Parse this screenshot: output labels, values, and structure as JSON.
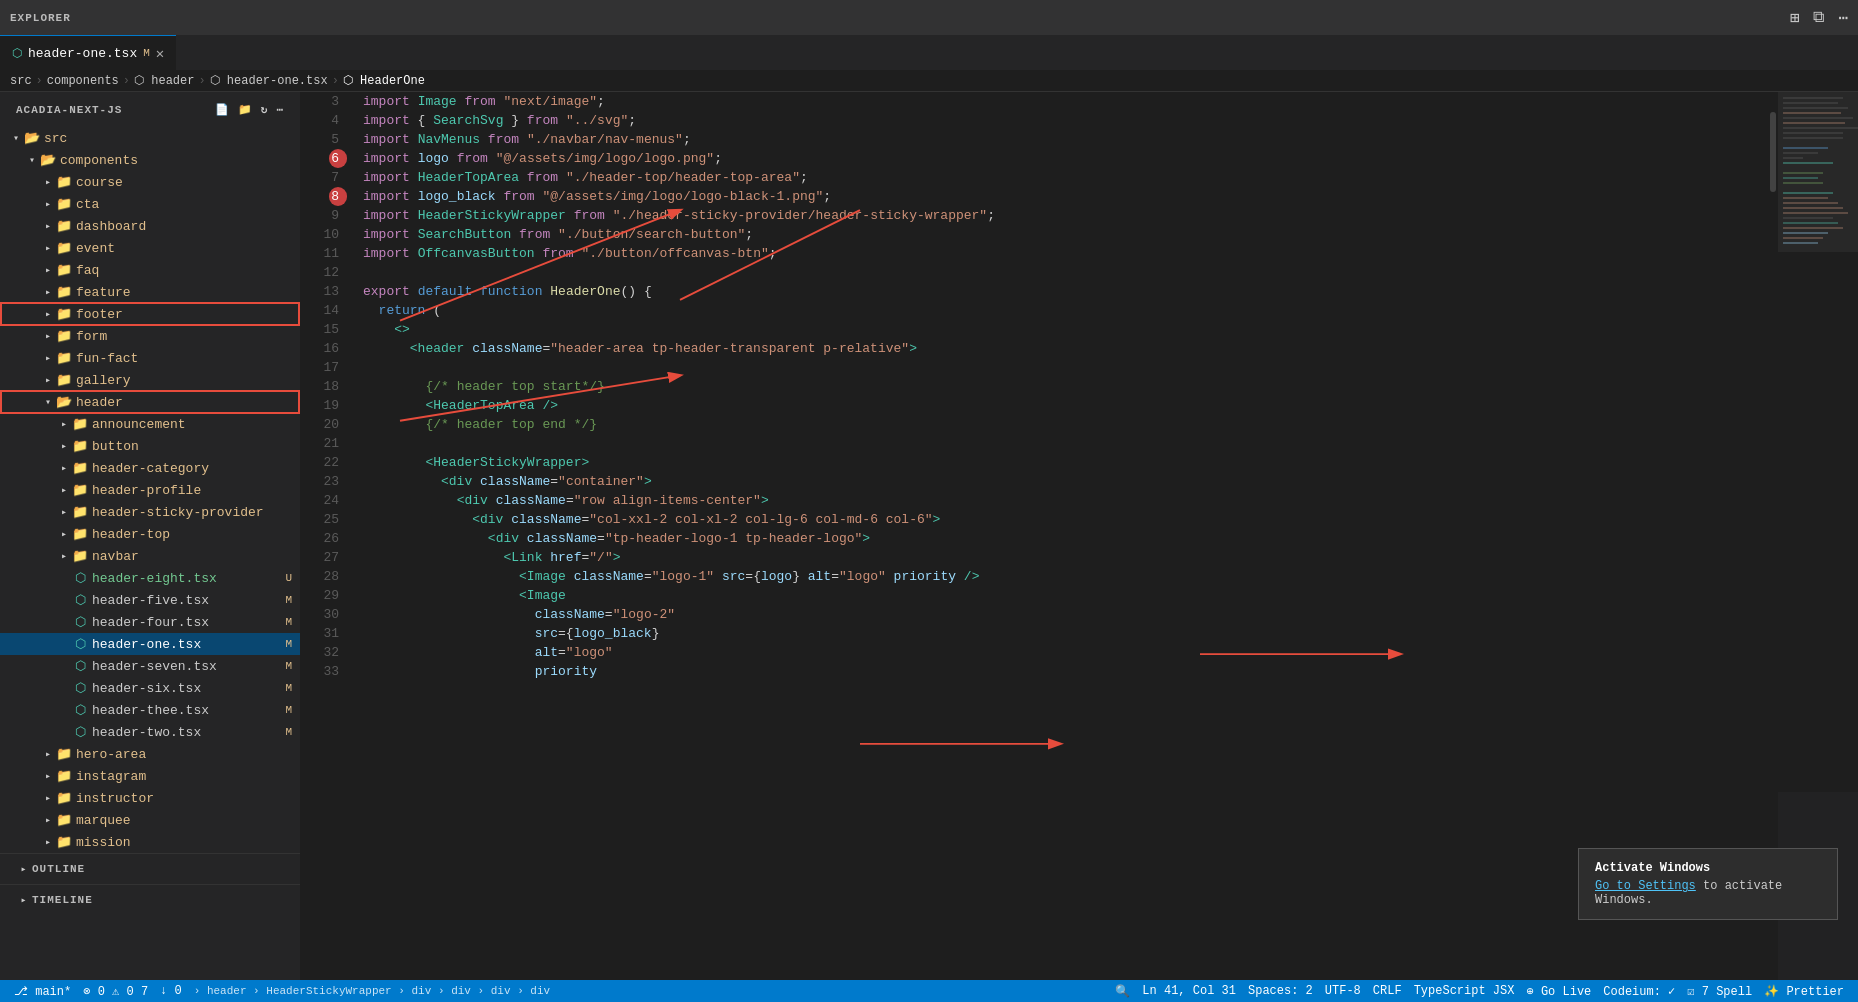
{
  "titlebar": {
    "explorer_label": "EXPLORER",
    "icons": [
      "⋯"
    ]
  },
  "tabs": [
    {
      "id": "header-one",
      "label": "header-one.tsx",
      "badge": "M",
      "active": true,
      "closable": true
    }
  ],
  "breadcrumb": [
    "src",
    "components",
    "header",
    "header-one.tsx",
    "HeaderOne"
  ],
  "project": {
    "name": "ACADIA-NEXT-JS",
    "root": "src",
    "tree": [
      {
        "type": "folder",
        "label": "src",
        "indent": 0,
        "expanded": true
      },
      {
        "type": "folder",
        "label": "components",
        "indent": 1,
        "expanded": true
      },
      {
        "type": "folder",
        "label": "course",
        "indent": 2,
        "expanded": false
      },
      {
        "type": "folder",
        "label": "cta",
        "indent": 2,
        "expanded": false
      },
      {
        "type": "folder",
        "label": "dashboard",
        "indent": 2,
        "expanded": false
      },
      {
        "type": "folder",
        "label": "event",
        "indent": 2,
        "expanded": false
      },
      {
        "type": "folder",
        "label": "faq",
        "indent": 2,
        "expanded": false
      },
      {
        "type": "folder",
        "label": "feature",
        "indent": 2,
        "expanded": false
      },
      {
        "type": "folder",
        "label": "footer",
        "indent": 2,
        "expanded": false
      },
      {
        "type": "folder",
        "label": "form",
        "indent": 2,
        "expanded": false
      },
      {
        "type": "folder",
        "label": "fun-fact",
        "indent": 2,
        "expanded": false
      },
      {
        "type": "folder",
        "label": "gallery",
        "indent": 2,
        "expanded": false
      },
      {
        "type": "folder",
        "label": "header",
        "indent": 2,
        "expanded": true,
        "selected": true
      },
      {
        "type": "folder",
        "label": "announcement",
        "indent": 3,
        "expanded": false
      },
      {
        "type": "folder",
        "label": "button",
        "indent": 3,
        "expanded": false
      },
      {
        "type": "folder",
        "label": "header-category",
        "indent": 3,
        "expanded": false
      },
      {
        "type": "folder",
        "label": "header-profile",
        "indent": 3,
        "expanded": false
      },
      {
        "type": "folder",
        "label": "header-sticky-provider",
        "indent": 3,
        "expanded": false
      },
      {
        "type": "folder",
        "label": "header-top",
        "indent": 3,
        "expanded": false
      },
      {
        "type": "folder",
        "label": "navbar",
        "indent": 3,
        "expanded": false
      },
      {
        "type": "file",
        "label": "header-eight.tsx",
        "indent": 3,
        "badge": "U"
      },
      {
        "type": "file",
        "label": "header-five.tsx",
        "indent": 3,
        "badge": "M"
      },
      {
        "type": "file",
        "label": "header-four.tsx",
        "indent": 3,
        "badge": "M"
      },
      {
        "type": "file",
        "label": "header-one.tsx",
        "indent": 3,
        "badge": "M",
        "active": true
      },
      {
        "type": "file",
        "label": "header-seven.tsx",
        "indent": 3,
        "badge": "M"
      },
      {
        "type": "file",
        "label": "header-six.tsx",
        "indent": 3,
        "badge": "M"
      },
      {
        "type": "file",
        "label": "header-thee.tsx",
        "indent": 3,
        "badge": "M"
      },
      {
        "type": "file",
        "label": "header-two.tsx",
        "indent": 3,
        "badge": "M"
      },
      {
        "type": "folder",
        "label": "hero-area",
        "indent": 2,
        "expanded": false
      },
      {
        "type": "folder",
        "label": "instagram",
        "indent": 2,
        "expanded": false
      },
      {
        "type": "folder",
        "label": "instructor",
        "indent": 2,
        "expanded": false
      },
      {
        "type": "folder",
        "label": "marquee",
        "indent": 2,
        "expanded": false
      },
      {
        "type": "folder",
        "label": "mission",
        "indent": 2,
        "expanded": false
      }
    ]
  },
  "outline": {
    "label": "OUTLINE"
  },
  "timeline": {
    "label": "TIMELINE"
  },
  "code": {
    "lines": [
      {
        "num": 3,
        "content": "import_image_line"
      },
      {
        "num": 4,
        "content": "import_searchsvg_line"
      },
      {
        "num": 5,
        "content": "import_navmenus_line"
      },
      {
        "num": 6,
        "content": "import_logo_line",
        "breakpoint": true
      },
      {
        "num": 7,
        "content": "import_headertoparea_line"
      },
      {
        "num": 8,
        "content": "import_logoblack_line",
        "breakpoint": true
      },
      {
        "num": 9,
        "content": "import_headerstickywrapper_line"
      },
      {
        "num": 10,
        "content": "import_searchbutton_line"
      },
      {
        "num": 11,
        "content": "import_offcanvasbutton_line"
      },
      {
        "num": 12,
        "content": "blank"
      },
      {
        "num": 13,
        "content": "export_default_line"
      },
      {
        "num": 14,
        "content": "return_line"
      },
      {
        "num": 15,
        "content": "fragment_open"
      },
      {
        "num": 16,
        "content": "header_jsx_line"
      },
      {
        "num": 17,
        "content": "blank2"
      },
      {
        "num": 18,
        "content": "header_top_comment_start"
      },
      {
        "num": 19,
        "content": "headertoparea_selfclose"
      },
      {
        "num": 20,
        "content": "header_top_comment_end"
      },
      {
        "num": 21,
        "content": "blank3"
      },
      {
        "num": 22,
        "content": "headerstickywrapper_open"
      },
      {
        "num": 23,
        "content": "div_container"
      },
      {
        "num": 24,
        "content": "div_row"
      },
      {
        "num": 25,
        "content": "div_col_xxl"
      },
      {
        "num": 26,
        "content": "div_logo_wrapper"
      },
      {
        "num": 27,
        "content": "link_href"
      },
      {
        "num": 28,
        "content": "image_logo1"
      },
      {
        "num": 29,
        "content": "image_logo2_open"
      },
      {
        "num": 30,
        "content": "classname_logo2"
      },
      {
        "num": 31,
        "content": "src_logo_black"
      },
      {
        "num": 32,
        "content": "alt_logo"
      },
      {
        "num": 33,
        "content": "priority"
      }
    ],
    "raw": [
      "import Image from \"next/image\";",
      "import { SearchSvg } from \"../svg\";",
      "import NavMenus from \"./navbar/nav-menus\";",
      "import logo from \"@/assets/img/logo/logo.png\";",
      "import HeaderTopArea from \"./header-top/header-top-area\";",
      "import logo_black from \"@/assets/img/logo/logo-black-1.png\";",
      "import HeaderStickyWrapper from \"./header-sticky-provider/header-sticky-wrapper\";",
      "import SearchButton from \"./button/search-button\";",
      "import OffcanvasButton from \"./button/offcanvas-btn\";",
      "",
      "export default function HeaderOne() {",
      "  return (",
      "    <>",
      "      <header className=\"header-area tp-header-transparent p-relative\">",
      "",
      "        {/* header top start*/}",
      "        <HeaderTopArea />",
      "        {/* header top end */}",
      "",
      "        <HeaderStickyWrapper>",
      "          <div className=\"container\">",
      "            <div className=\"row align-items-center\">",
      "              <div className=\"col-xxl-2 col-xl-2 col-lg-6 col-md-6 col-6\">",
      "                <div className=\"tp-header-logo-1 tp-header-logo\">",
      "                  <Link href=\"/\">",
      "                    <Image className=\"logo-1\" src={logo} alt=\"logo\" priority />",
      "                    <Image",
      "                      className=\"logo-2\"",
      "                      src={logo_black}",
      "                      alt=\"logo\"",
      "                      priority"
    ]
  },
  "statusbar": {
    "left": [
      {
        "id": "branch",
        "text": "⎇  main*"
      },
      {
        "id": "errors",
        "text": "⊗ 0  ⚠ 0  7"
      },
      {
        "id": "git",
        "text": "↓ 0"
      }
    ],
    "right": [
      {
        "id": "cursor",
        "text": "Ln 41, Col 31"
      },
      {
        "id": "spaces",
        "text": "Spaces: 2"
      },
      {
        "id": "encoding",
        "text": "UTF-8"
      },
      {
        "id": "eol",
        "text": "CRLF"
      },
      {
        "id": "language",
        "text": "TypeScript JSX"
      },
      {
        "id": "live",
        "text": "⊕ Go Live"
      },
      {
        "id": "codeium",
        "text": "Codeium: ✓"
      },
      {
        "id": "spell",
        "text": "☑ 7 Spell"
      },
      {
        "id": "prettier",
        "text": "✨ Prettier"
      }
    ],
    "center_items": [
      {
        "id": "breadcrumb2",
        "text": "› header › HeaderStickyWrapper › div › div › div › div"
      }
    ]
  },
  "activation": {
    "title": "Activate Windows",
    "text": "Go to Settings to activate Windows.",
    "link": "Go to Settings"
  }
}
